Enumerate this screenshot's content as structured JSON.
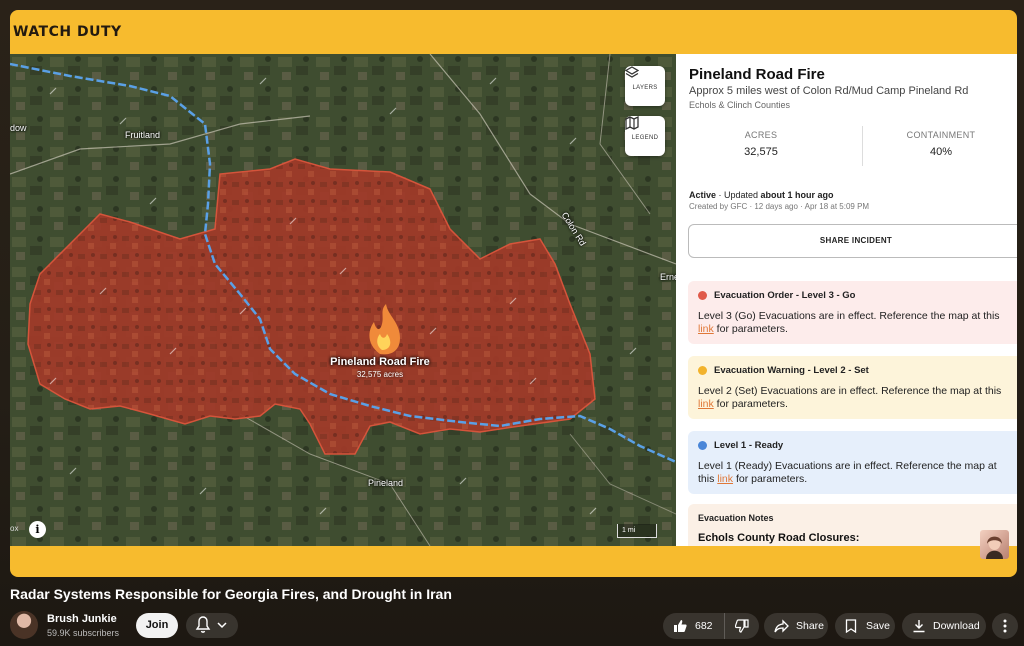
{
  "video": {
    "brand": "WATCH DUTY",
    "map": {
      "layers_label": "LAYERS",
      "legend_label": "LEGEND",
      "places": [
        "Fruitland",
        "Colon Rd",
        "Erne",
        "Pineland",
        "dow",
        "ox"
      ],
      "fire_label": "Pineland Road Fire",
      "fire_acres": "32,575 acres",
      "scale": "1 mi",
      "colors": {
        "fire": "#b83a28",
        "river": "#5aa0e6"
      }
    },
    "panel": {
      "title": "Pineland Road Fire",
      "location": "Approx 5 miles west of Colon Rd/Mud Camp Pineland Rd",
      "counties": "Echols & Clinch Counties",
      "acres_label": "ACRES",
      "acres_value": "32,575",
      "containment_label": "CONTAINMENT",
      "containment_value": "40%",
      "status_prefix": "Active",
      "status_mid": " · Updated ",
      "status_updated": "about 1 hour ago",
      "created": "Created by GFC · 12 days ago · Apr 18 at 5:09 PM",
      "share_label": "SHARE INCIDENT",
      "alerts": [
        {
          "title": "Evacuation Order - Level 3 - Go",
          "text_a": "Level 3 (Go) Evacuations are in effect. Reference the map at this ",
          "link": "link",
          "text_b": " for parameters.",
          "color": "#e05a4a",
          "bg": "#fdeceb"
        },
        {
          "title": "Evacuation Warning - Level 2 - Set",
          "text_a": "Level 2 (Set) Evacuations are in effect. Reference the map at this ",
          "link": "link",
          "text_b": " for parameters.",
          "color": "#f2b32c",
          "bg": "#fdf4da"
        },
        {
          "title": "Level 1 - Ready",
          "text_a": "Level 1 (Ready) Evacuations are in effect. Reference the map at this ",
          "link": "link",
          "text_b": " for parameters.",
          "color": "#4a86d8",
          "bg": "#e6effb"
        }
      ],
      "notes_title": "Evacuation Notes",
      "notes_content": "Echols County Road Closures:"
    }
  },
  "title": "Radar Systems Responsible for Georgia Fires, and Drought in Iran",
  "channel": {
    "name": "Brush Junkie",
    "subscribers": "59.9K subscribers",
    "join_label": "Join"
  },
  "actions": {
    "likes": "682",
    "share": "Share",
    "save": "Save",
    "download": "Download"
  }
}
